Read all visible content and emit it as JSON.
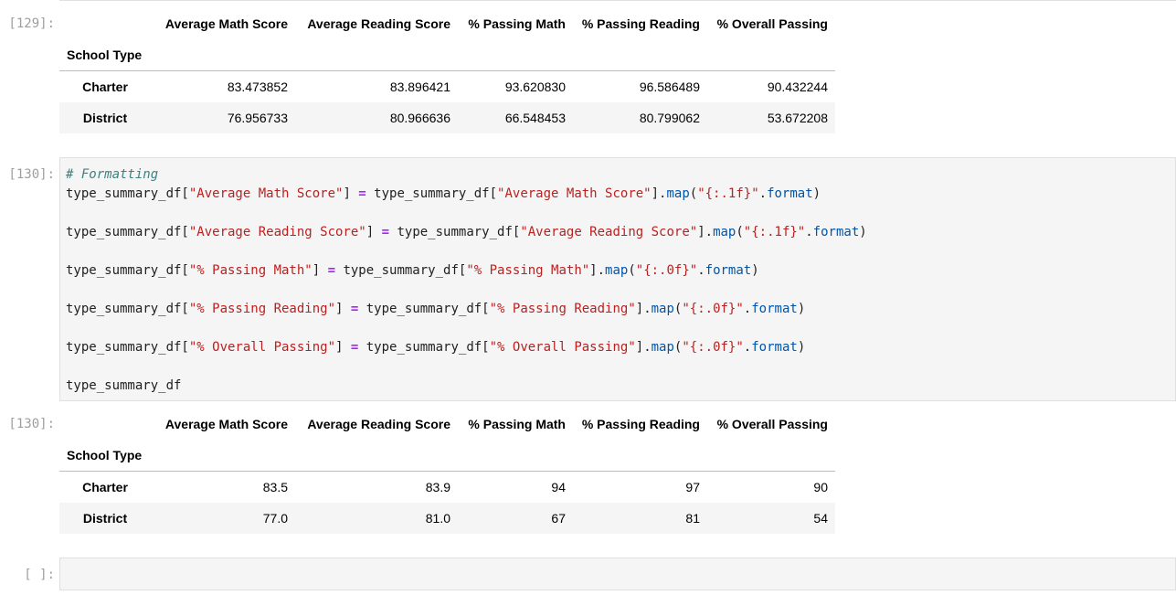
{
  "notebook": {
    "cells": [
      {
        "type": "output",
        "prompt": "[129]:",
        "table": {
          "columns": [
            "Average Math Score",
            "Average Reading Score",
            "% Passing Math",
            "% Passing Reading",
            "% Overall Passing"
          ],
          "index_name": "School Type",
          "rows": [
            {
              "label": "Charter",
              "values": [
                "83.473852",
                "83.896421",
                "93.620830",
                "96.586489",
                "90.432244"
              ]
            },
            {
              "label": "District",
              "values": [
                "76.956733",
                "80.966636",
                "66.548453",
                "80.799062",
                "53.672208"
              ]
            }
          ]
        }
      },
      {
        "type": "code",
        "prompt": "[130]:",
        "comment": "# Formatting",
        "lines": [
          {
            "lhs": "type_summary_df[",
            "key": "\"Average Math Score\"",
            "mid": "] = type_summary_df[",
            "key2": "\"Average Math Score\"",
            "map": "map",
            "fmt": "\"{:.1f}\"",
            "format": "format"
          },
          {
            "lhs": "type_summary_df[",
            "key": "\"Average Reading Score\"",
            "mid": "] = type_summary_df[",
            "key2": "\"Average Reading Score\"",
            "map": "map",
            "fmt": "\"{:.1f}\"",
            "format": "format"
          },
          {
            "lhs": "type_summary_df[",
            "key": "\"% Passing Math\"",
            "mid": "] = type_summary_df[",
            "key2": "\"% Passing Math\"",
            "map": "map",
            "fmt": "\"{:.0f}\"",
            "format": "format"
          },
          {
            "lhs": "type_summary_df[",
            "key": "\"% Passing Reading\"",
            "mid": "] = type_summary_df[",
            "key2": "\"% Passing Reading\"",
            "map": "map",
            "fmt": "\"{:.0f}\"",
            "format": "format"
          },
          {
            "lhs": "type_summary_df[",
            "key": "\"% Overall Passing\"",
            "mid": "] = type_summary_df[",
            "key2": "\"% Overall Passing\"",
            "map": "map",
            "fmt": "\"{:.0f}\"",
            "format": "format"
          }
        ],
        "last_line": "type_summary_df"
      },
      {
        "type": "output",
        "prompt": "[130]:",
        "table": {
          "columns": [
            "Average Math Score",
            "Average Reading Score",
            "% Passing Math",
            "% Passing Reading",
            "% Overall Passing"
          ],
          "index_name": "School Type",
          "rows": [
            {
              "label": "Charter",
              "values": [
                "83.5",
                "83.9",
                "94",
                "97",
                "90"
              ]
            },
            {
              "label": "District",
              "values": [
                "77.0",
                "81.0",
                "67",
                "81",
                "54"
              ]
            }
          ]
        }
      },
      {
        "type": "code",
        "prompt": "[ ]:",
        "text": ""
      }
    ]
  }
}
